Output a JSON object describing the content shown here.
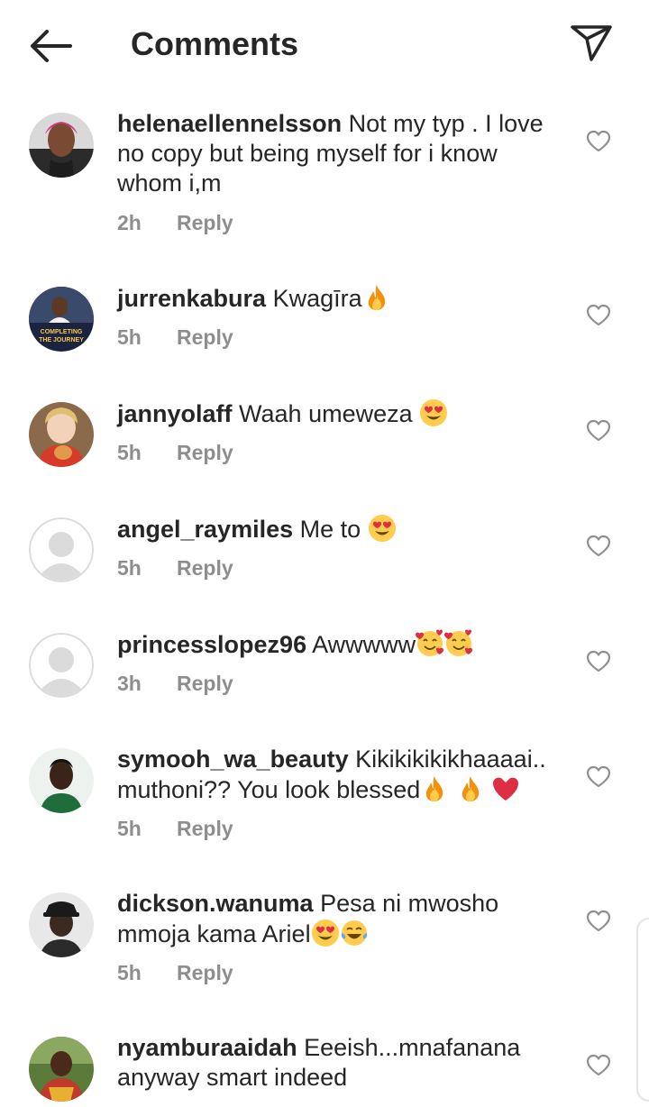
{
  "header": {
    "title": "Comments",
    "back_icon": "arrow-left-icon",
    "send_icon": "paper-plane-icon"
  },
  "colors": {
    "text": "#262626",
    "meta": "#8e8e8e",
    "heart_outline": "#8e8e8e",
    "placeholder_avatar": "#dbdbdb"
  },
  "reply_label": "Reply",
  "comments": [
    {
      "username": "helenaellennelsson",
      "lines": [
        "Not my typ . I love",
        "no copy but being myself for i know",
        "whom i,m"
      ],
      "emojis": [],
      "time": "2h"
    },
    {
      "username": "jurrenkabura",
      "lines": [
        "Kwagīra"
      ],
      "emojis": [
        "fire"
      ],
      "avatar_text": [
        "COMPLETING",
        "THE JOURNEY"
      ],
      "time": "5h"
    },
    {
      "username": "jannyolaff",
      "lines": [
        "Waah umeweza"
      ],
      "emojis": [
        "heart-eyes"
      ],
      "time": "5h"
    },
    {
      "username": "angel_raymiles",
      "lines": [
        "Me to"
      ],
      "emojis": [
        "heart-eyes"
      ],
      "time": "5h"
    },
    {
      "username": "princesslopez96",
      "lines": [
        "Awwwww"
      ],
      "emojis": [
        "smiling-hearts",
        "smiling-hearts"
      ],
      "time": "3h"
    },
    {
      "username": "symooh_wa_beauty",
      "lines": [
        "Kikikikikikhaaaai..",
        "muthoni?? You look blessed"
      ],
      "emojis": [
        "fire",
        "fire",
        "red-heart"
      ],
      "time": "5h"
    },
    {
      "username": "dickson.wanuma",
      "lines": [
        "Pesa ni mwosho",
        "mmoja kama Ariel"
      ],
      "emojis": [
        "heart-eyes",
        "tears-of-joy"
      ],
      "time": "5h"
    },
    {
      "username": "nyamburaaidah",
      "lines": [
        "Eeeish...mnafanana",
        "anyway smart indeed"
      ],
      "emojis": [],
      "time": ""
    }
  ]
}
